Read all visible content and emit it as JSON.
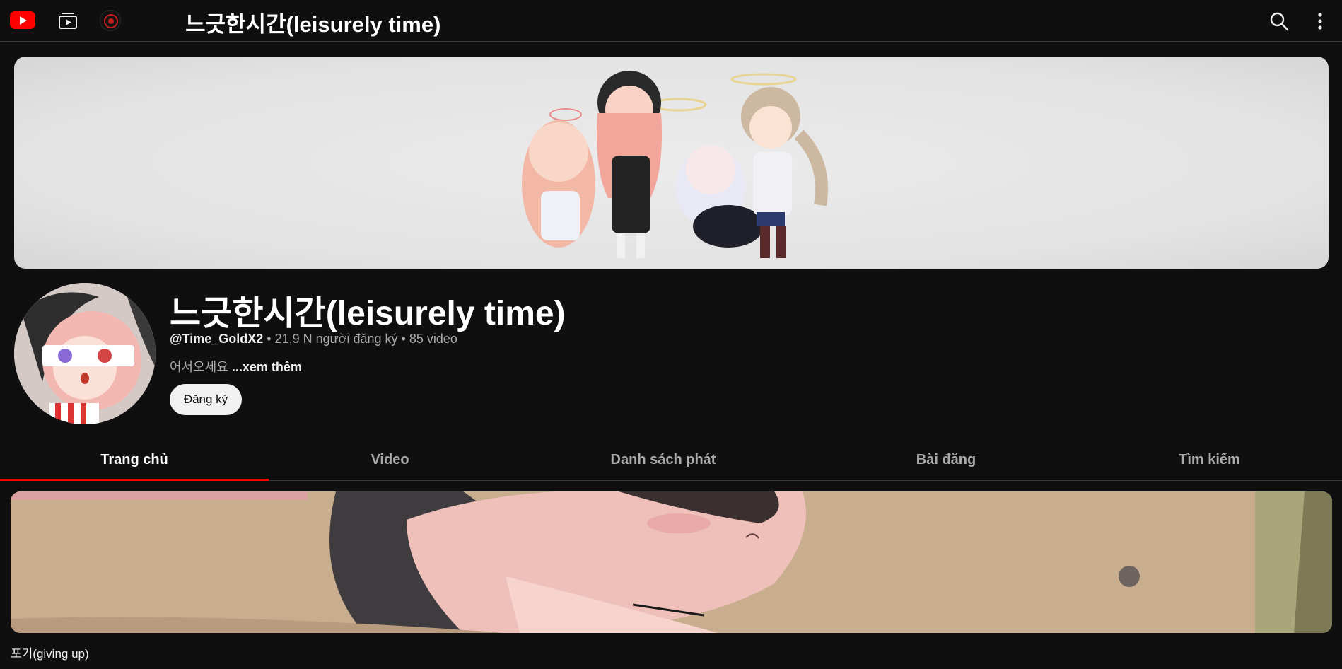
{
  "header": {
    "title": "느긋한시간(leisurely time)"
  },
  "channel": {
    "name": "느긋한시간(leisurely time)",
    "handle": "@Time_GoldX2",
    "subscribers": "21,9 N người đăng ký",
    "video_count": "85 video",
    "separator": " • ",
    "description": "어서오세요",
    "more_label": "...xem thêm",
    "subscribe_label": "Đăng ký"
  },
  "tabs": [
    {
      "label": "Trang chủ",
      "active": true
    },
    {
      "label": "Video",
      "active": false
    },
    {
      "label": "Danh sách phát",
      "active": false
    },
    {
      "label": "Bài đăng",
      "active": false
    },
    {
      "label": "Tìm kiếm",
      "active": false
    }
  ],
  "featured_video": {
    "title": "포기(giving up)"
  },
  "colors": {
    "background": "#0f0f0f",
    "accent": "#ff0000",
    "text_primary": "#f1f1f1",
    "text_secondary": "#aaaaaa"
  },
  "icons": {
    "logo": "youtube-logo-icon",
    "subscriptions": "subscriptions-icon",
    "search": "search-icon",
    "more": "more-vert-icon"
  }
}
